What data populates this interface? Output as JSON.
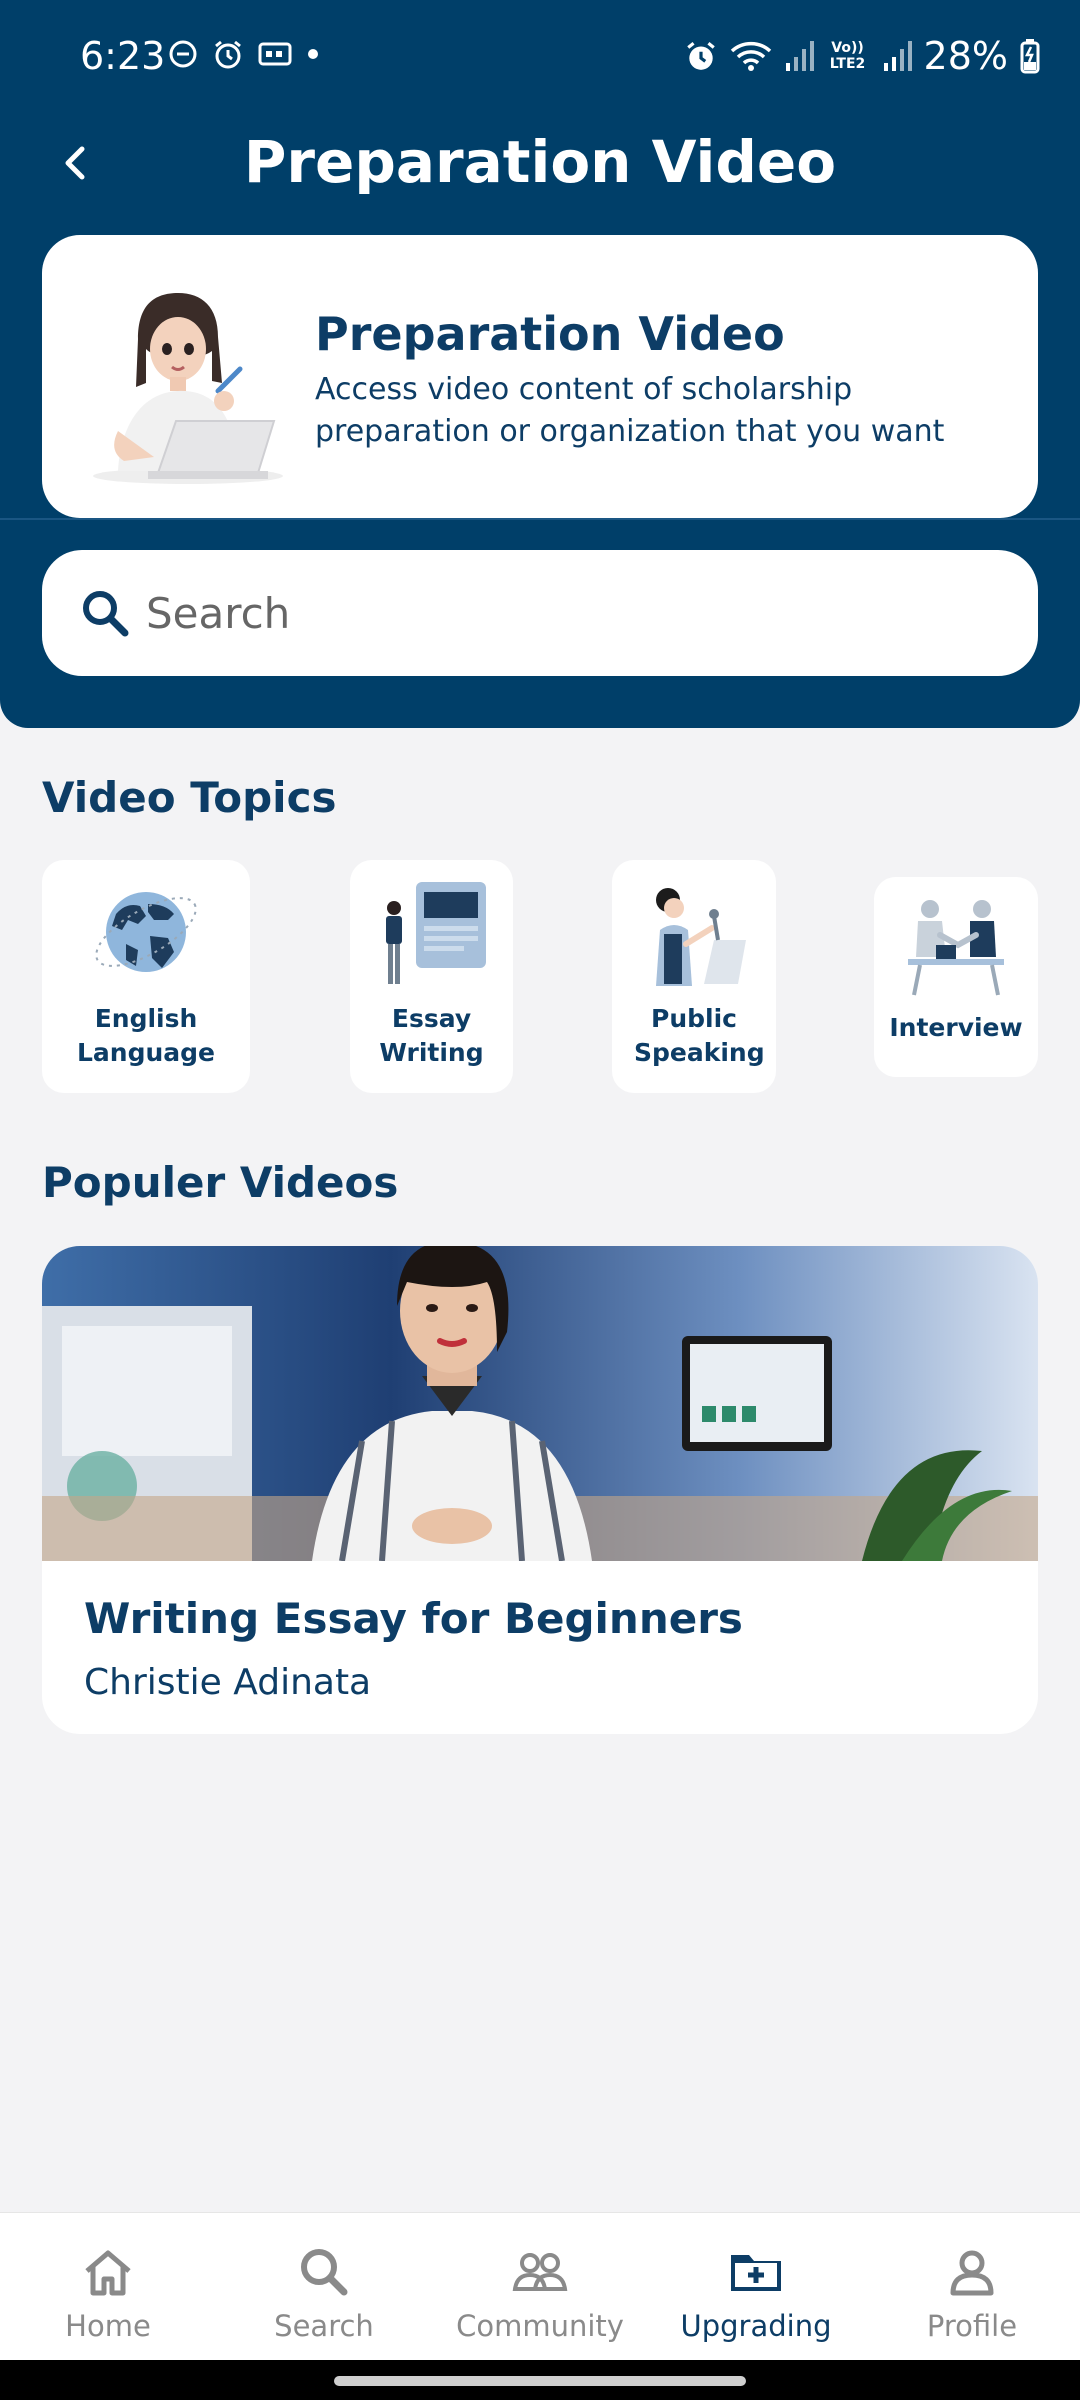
{
  "status_bar": {
    "time": "6:23",
    "network": "Vo)) LTE2",
    "battery": "28%"
  },
  "header": {
    "title": "Preparation Video",
    "back_icon": "chevron-left-icon"
  },
  "banner": {
    "title": "Preparation Video",
    "description": "Access video content of scholarship preparation or organization that you want"
  },
  "search": {
    "placeholder": "Search"
  },
  "video_topics": {
    "title": "Video Topics",
    "items": [
      {
        "label": "English Language"
      },
      {
        "label": "Essay Writing"
      },
      {
        "label": "Public Speaking"
      },
      {
        "label": "Interview"
      }
    ]
  },
  "popular_videos": {
    "title": "Populer Videos",
    "items": [
      {
        "title": "Writing Essay for Beginners",
        "author": "Christie Adinata"
      }
    ]
  },
  "bottom_nav": {
    "items": [
      {
        "label": "Home",
        "icon": "home-icon"
      },
      {
        "label": "Search",
        "icon": "search-icon"
      },
      {
        "label": "Community",
        "icon": "community-icon"
      },
      {
        "label": "Upgrading",
        "icon": "folder-plus-icon"
      },
      {
        "label": "Profile",
        "icon": "profile-icon"
      }
    ],
    "active": "Upgrading"
  },
  "colors": {
    "primary": "#003f69",
    "text_dark": "#0d3d66",
    "background": "#f3f3f5"
  }
}
